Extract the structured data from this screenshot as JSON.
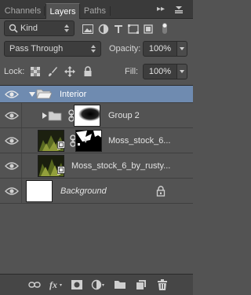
{
  "tabs": [
    {
      "label": "Channels",
      "active": false
    },
    {
      "label": "Layers",
      "active": true
    },
    {
      "label": "Paths",
      "active": false
    }
  ],
  "filter": {
    "kind_label": "Kind",
    "icons": [
      "pixel-filter-icon",
      "adjustment-filter-icon",
      "type-filter-icon",
      "shape-filter-icon",
      "smart-object-filter-icon",
      "filter-toggle-icon"
    ]
  },
  "blend": {
    "mode": "Pass Through",
    "opacity_label": "Opacity:",
    "opacity_value": "100%"
  },
  "lock": {
    "label": "Lock:",
    "fill_label": "Fill:",
    "fill_value": "100%"
  },
  "layers": [
    {
      "name": "Interior",
      "type": "group-open",
      "selected": true
    },
    {
      "name": "Group 2",
      "type": "group-closed",
      "selected": false
    },
    {
      "name": "Moss_stock_6...",
      "type": "smart-masked",
      "selected": false
    },
    {
      "name": "Moss_stock_6_by_rusty...",
      "type": "smart",
      "selected": false
    },
    {
      "name": "Background",
      "type": "background",
      "selected": false
    }
  ],
  "colors": {
    "selected_row": "#6f8bb0",
    "panel_bg": "#535353",
    "tab_bar": "#3a3a3a"
  }
}
